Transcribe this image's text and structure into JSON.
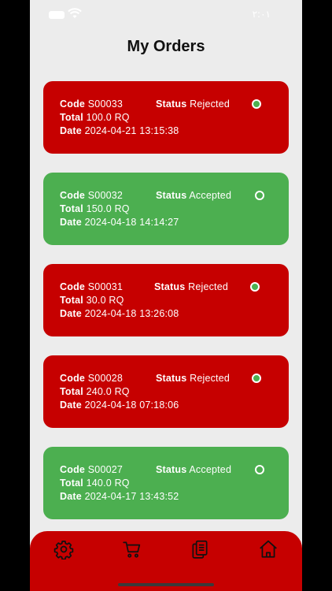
{
  "status_bar": {
    "time": "٢:٠١"
  },
  "page": {
    "title": "My Orders"
  },
  "labels": {
    "code": "Code",
    "status": "Status",
    "total": "Total",
    "date": "Date"
  },
  "orders": [
    {
      "code": "S00033",
      "status": "Rejected",
      "total": "100.0 RQ",
      "date": "2024-04-21 13:15:38"
    },
    {
      "code": "S00032",
      "status": "Accepted",
      "total": "150.0 RQ",
      "date": "2024-04-18 14:14:27"
    },
    {
      "code": "S00031",
      "status": "Rejected",
      "total": "30.0 RQ",
      "date": "2024-04-18 13:26:08"
    },
    {
      "code": "S00028",
      "status": "Rejected",
      "total": "240.0 RQ",
      "date": "2024-04-18 07:18:06"
    },
    {
      "code": "S00027",
      "status": "Accepted",
      "total": "140.0 RQ",
      "date": "2024-04-17 13:43:52"
    }
  ],
  "colors": {
    "rejected": "#c60000",
    "accepted": "#4caf50",
    "nav": "#c60000"
  },
  "bottom_nav": {
    "icons": [
      "gear-icon",
      "cart-icon",
      "documents-icon",
      "home-icon"
    ]
  }
}
